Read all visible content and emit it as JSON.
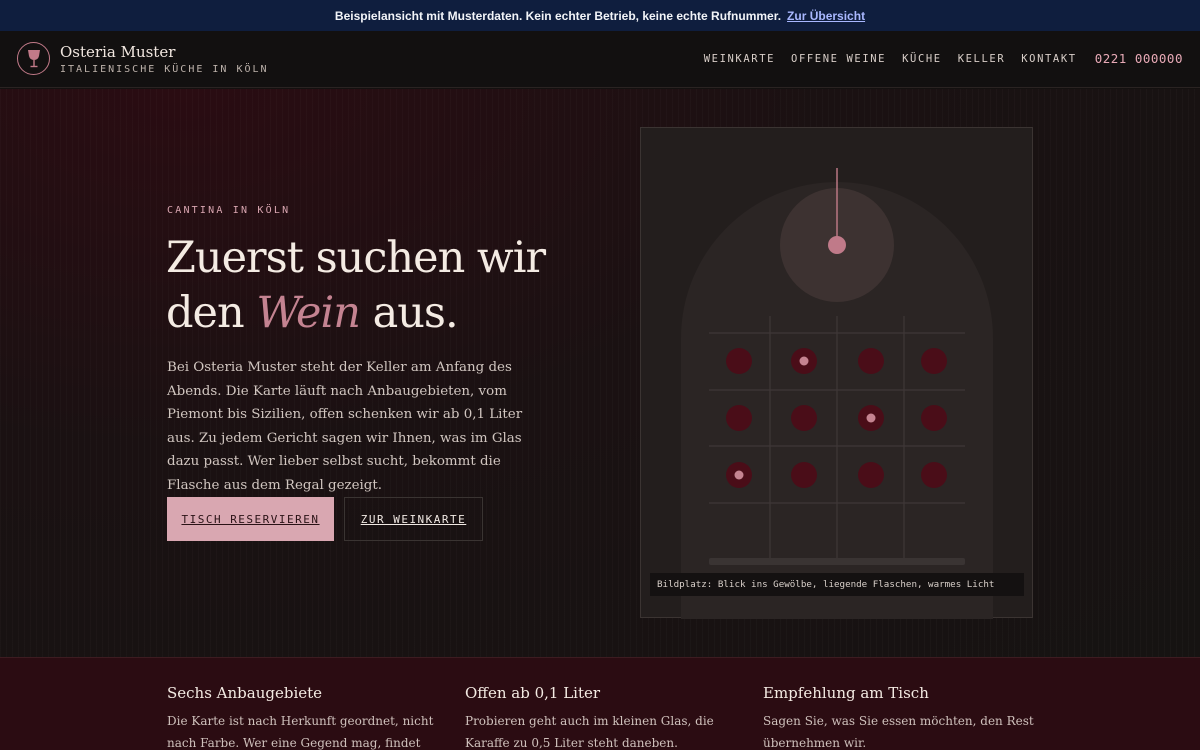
{
  "notice": {
    "message": "Beispielansicht mit Musterdaten. Kein echter Betrieb, keine echte Rufnummer.",
    "link": "Zur Übersicht"
  },
  "header": {
    "brand_name": "Osteria Muster",
    "tagline": "ITALIENISCHE KÜCHE IN KÖLN",
    "logo_icon": "wine-glass-icon",
    "nav": [
      "WEINKARTE",
      "OFFENE WEINE",
      "KÜCHE",
      "KELLER",
      "KONTAKT"
    ],
    "phone": "0221 000000"
  },
  "hero": {
    "eyebrow": "CANTINA IN KÖLN",
    "headline_line1": "Zuerst suchen wir",
    "headline_pre": "den ",
    "headline_em": "Wein",
    "headline_post": " aus.",
    "intro": "Bei Osteria Muster steht der Keller am Anfang des Abends. Die Karte läuft nach Anbaugebieten, vom Piemont bis Sizilien, offen schenken wir ab 0,1 Liter aus. Zu jedem Gericht sagen wir Ihnen, was im Glas dazu passt. Wer lieber selbst sucht, bekommt die Flasche aus dem Regal gezeigt.",
    "primary_button": "TISCH RESERVIEREN",
    "secondary_button": "ZUR WEINKARTE",
    "image_caption": "Bildplatz: Blick ins Gewölbe, liegende Flaschen, warmes Licht"
  },
  "features": [
    {
      "title": "Sechs Anbaugebiete",
      "text": "Die Karte ist nach Herkunft geordnet, nicht nach Farbe. Wer eine Gegend mag, findet ihre Weine"
    },
    {
      "title": "Offen ab 0,1 Liter",
      "text": "Probieren geht auch im kleinen Glas, die Karaffe zu 0,5 Liter steht daneben."
    },
    {
      "title": "Empfehlung am Tisch",
      "text": "Sagen Sie, was Sie essen möchten, den Rest übernehmen wir."
    }
  ],
  "colors": {
    "notice_bg": "#0f1e3e",
    "accent_rose": "#d9a7b1",
    "wine": "#c48391",
    "features_bg": "#2b0c12"
  }
}
